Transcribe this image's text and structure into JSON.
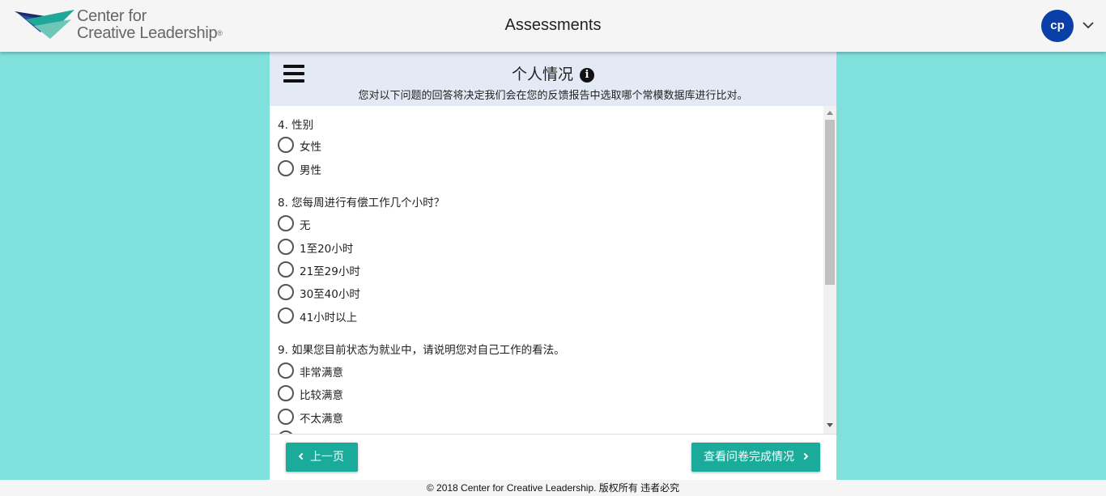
{
  "header": {
    "logo_line1": "Center for",
    "logo_line2": "Creative Leadership",
    "logo_tm": "®",
    "title": "Assessments",
    "user_initials": "cp"
  },
  "section": {
    "title": "个人情况",
    "info_glyph": "i",
    "subtitle": "您对以下问题的回答将决定我们会在您的反馈报告中选取哪个常模数据库进行比对。"
  },
  "questions": [
    {
      "label": "4. 性别",
      "options": [
        "女性",
        "男性"
      ]
    },
    {
      "label": "8. 您每周进行有偿工作几个小时？",
      "options": [
        "无",
        "1至20小时",
        "21至29小时",
        "30至40小时",
        "41小时以上"
      ]
    },
    {
      "label": "9. 如果您目前状态为就业中，请说明您对自己工作的看法。",
      "options": [
        "非常满意",
        "比较满意",
        "不太满意"
      ]
    }
  ],
  "nav": {
    "prev_label": "上一页",
    "next_label": "查看问卷完成情况"
  },
  "footer": {
    "copyright": "© 2018 Center for Creative Leadership. 版权所有 违者必究"
  },
  "colors": {
    "page_background": "#80e0dc",
    "accent_button": "#1aab9b",
    "avatar": "#0b3fa8",
    "panel_header": "#e3eaf5"
  },
  "icons": {
    "menu": "menu-icon",
    "info": "info-icon",
    "user_menu": "chevron-down-icon",
    "prev": "chevron-left-icon",
    "next": "chevron-right-icon"
  }
}
